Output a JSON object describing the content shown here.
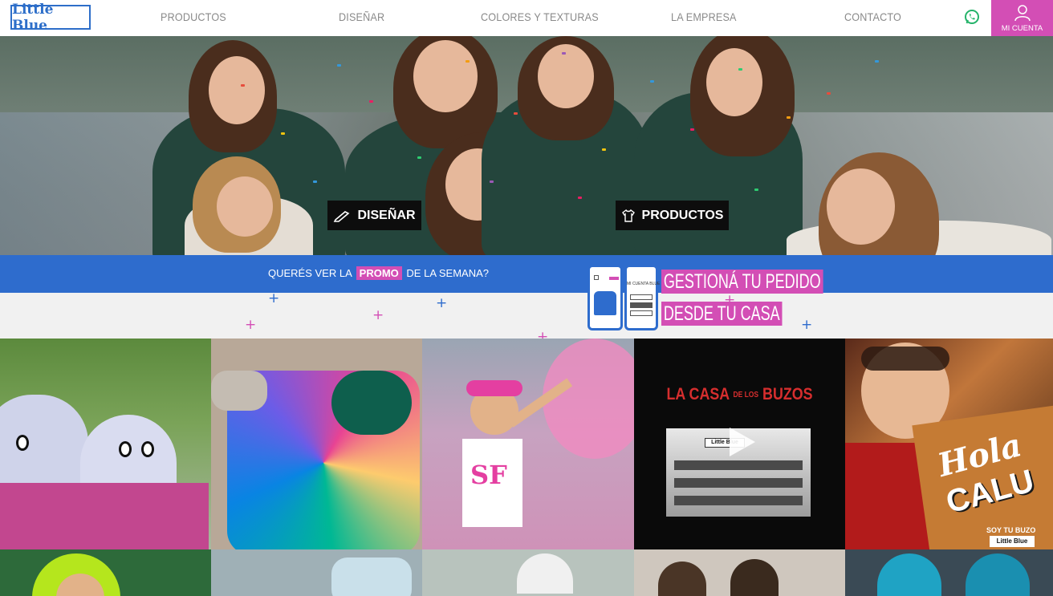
{
  "brand": {
    "logo_text": "Little Blue"
  },
  "nav": {
    "items": [
      {
        "label": "PRODUCTOS"
      },
      {
        "label": "DISEÑAR"
      },
      {
        "label": "COLORES Y TEXTURAS"
      },
      {
        "label": "LA EMPRESA"
      },
      {
        "label": "CONTACTO"
      }
    ],
    "account_label": "MI CUENTA",
    "whatsapp_icon": "whatsapp-icon",
    "account_icon": "user-icon"
  },
  "hero": {
    "design_button": "DISEÑAR",
    "design_icon": "pencil-icon",
    "products_button": "PRODUCTOS",
    "products_icon": "tshirt-icon"
  },
  "promo": {
    "text_before": "QUERÉS VER LA",
    "highlight": "PROMO",
    "text_after": "DE LA SEMANA?",
    "banner_line1": "GESTIONÁ TU PEDIDO",
    "banner_line2": "DESDE TU CASA",
    "phone_label": "MI CUENTA BLUE"
  },
  "gallery": {
    "tiles": [
      {
        "name": "shark-hoodies"
      },
      {
        "name": "colorful-tiger-hoodie"
      },
      {
        "name": "pink-smoke-girl"
      },
      {
        "name": "la-casa-de-los-buzos-video",
        "title_a": "LA CASA",
        "title_b": "DE LOS",
        "title_c": "BUZOS",
        "building_sign": "Little Blue"
      },
      {
        "name": "hola-calu",
        "text_a": "Hola",
        "text_b": "CALU",
        "tagline": "SOY TU BUZO",
        "badge": "Little Blue"
      }
    ]
  },
  "colors": {
    "brand_blue": "#2e6ccd",
    "brand_pink": "#d34eb5",
    "whatsapp_green": "#25b36a"
  }
}
